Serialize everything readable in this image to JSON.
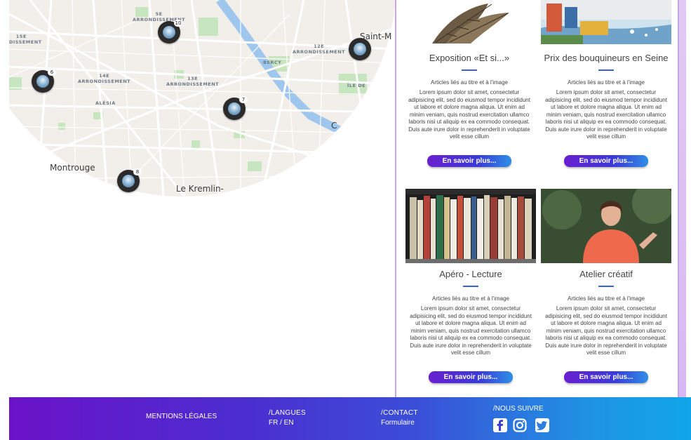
{
  "map": {
    "labels": {
      "arr5": [
        "5E",
        "ARRONDISSEMENT"
      ],
      "arr15": [
        "15E",
        "ONDISSEMENT"
      ],
      "arr12": [
        "12E",
        "ARRONDISSEMENT"
      ],
      "arr14": [
        "14E",
        "ARRONDISSEMENT"
      ],
      "arr13": [
        "13E",
        "ARRONDISSEMENT"
      ],
      "bercy": "BERCY",
      "alesia": "ALÉSIA",
      "ile": "ÎLE DE"
    },
    "places": {
      "saint_m": "Saint-M",
      "montrouge": "Montrouge",
      "kremlin": "Le Kremlin-",
      "ch": "C"
    },
    "markers": [
      {
        "count": "10"
      },
      {
        "count": "6"
      },
      {
        "count": "7"
      },
      {
        "count": "8"
      },
      {
        "count": ""
      }
    ],
    "colors": {
      "land": "#f2eeea",
      "park": "#c7e5bf",
      "water": "#9fc6ec",
      "road": "#ffffff"
    }
  },
  "cards": [
    {
      "title": "Exposition «Et si...»",
      "subtitle": "Articles liés au titre et à l'image",
      "body": "Lorem ipsum dolor sit amet, consectetur adipisicing elit, sed do eiusmod tempor incididunt ut labore et dolore magna aliqua. Ut enim ad minim veniam, quis nostrud exercitation ullamco laboris nisi ut aliquip ex ea commodo consequat. Duis aute irure dolor in reprehenderit in voluptate velit esse cillum",
      "button": "En savoir plus..."
    },
    {
      "title": "Prix des bouquineurs en Seine",
      "subtitle": "Articles liés au titre et à l'image",
      "body": "Lorem ipsum dolor sit amet, consectetur adipisicing elit, sed do eiusmod tempor incididunt ut labore et dolore magna aliqua. Ut enim ad minim veniam, quis nostrud exercitation ullamco laboris nisi ut aliquip ex ea commodo consequat. Duis aute irure dolor in reprehenderit in voluptate velit esse cillum",
      "button": "En savoir plus..."
    },
    {
      "title": "Apéro - Lecture",
      "subtitle": "Articles liés au titre et à l'image",
      "body": "Lorem ipsum dolor sit amet, consectetur adipisicing elit, sed do eiusmod tempor incididunt ut labore et dolore magna aliqua. Ut enim ad minim veniam, quis nostrud exercitation ullamco laboris nisi ut aliquip ex ea commodo consequat. Duis aute irure dolor in reprehenderit in voluptate velit esse cillum",
      "button": "En savoir plus..."
    },
    {
      "title": "Atelier créatif",
      "subtitle": "Articles liés au titre et à l'image",
      "body": "Lorem ipsum dolor sit amet, consectetur adipisicing elit, sed do eiusmod tempor incididunt ut labore et dolore magna aliqua. Ut enim ad minim veniam, quis nostrud exercitation ullamco laboris nisi ut aliquip ex ea commodo consequat. Duis aute irure dolor in reprehenderit in voluptate velit esse cillum",
      "button": "En savoir plus..."
    }
  ],
  "footer": {
    "mentions": "MENTIONS LÉGALES",
    "langues_head": "/LANGUES",
    "langues_value": "FR / EN",
    "contact_head": "/CONTACT",
    "contact_value": "Formulaire",
    "suivre_head": "/NOUS SUIVRE",
    "social": [
      "facebook-icon",
      "instagram-icon",
      "twitter-icon"
    ]
  },
  "colors": {
    "accent": "#3f5fd8",
    "panel_border": "#c9a6e8",
    "footer_start": "#6b12c9",
    "footer_end": "#10a6e8"
  }
}
